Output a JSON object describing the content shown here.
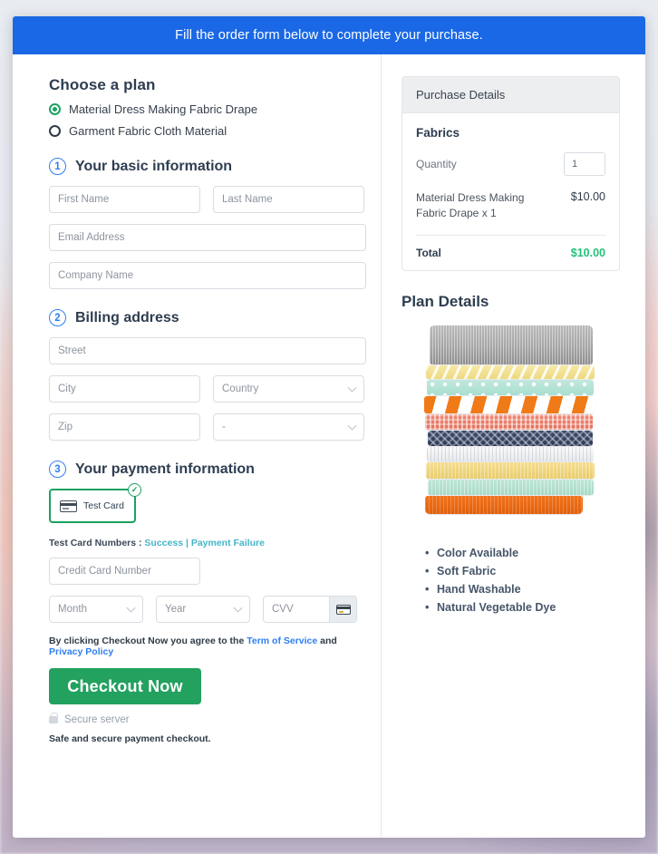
{
  "banner": {
    "text": "Fill the order form below to complete your purchase."
  },
  "plan": {
    "heading": "Choose a plan",
    "options": [
      {
        "label": "Material Dress Making Fabric Drape",
        "selected": true
      },
      {
        "label": "Garment Fabric Cloth Material",
        "selected": false
      }
    ]
  },
  "steps": {
    "basic": {
      "num": "1",
      "title": "Your basic information"
    },
    "billing": {
      "num": "2",
      "title": "Billing address"
    },
    "payment": {
      "num": "3",
      "title": "Your payment information"
    }
  },
  "fields": {
    "first_name": "First Name",
    "last_name": "Last Name",
    "email": "Email Address",
    "company": "Company Name",
    "street": "Street",
    "city": "City",
    "country": "Country",
    "zip": "Zip",
    "state": "-",
    "credit_card": "Credit Card Number",
    "month": "Month",
    "year": "Year",
    "cvv": "CVV"
  },
  "payment": {
    "tile_label": "Test  Card",
    "tile_selected": true,
    "check_glyph": "✓",
    "testcards_prefix": "Test Card Numbers : ",
    "testcards_success": "Success",
    "testcards_sep": " | ",
    "testcards_failure": "Payment Failure"
  },
  "terms": {
    "prefix": "By clicking Checkout Now you agree to the ",
    "tos": "Term of Service",
    "mid": " and ",
    "privacy": "Privacy Policy"
  },
  "checkout": {
    "button_label": "Checkout Now",
    "secure_label": "Secure server",
    "safe_label": "Safe and secure payment checkout."
  },
  "purchase": {
    "header": "Purchase Details",
    "group_title": "Fabrics",
    "quantity_label": "Quantity",
    "quantity_value": "1",
    "item_name": "Material Dress Making Fabric Drape x 1",
    "item_price": "$10.00",
    "total_label": "Total",
    "total_price": "$10.00"
  },
  "plan_details": {
    "title": "Plan Details",
    "image_alt": "stack-of-folded-fabrics",
    "features": [
      "Color Available",
      "Soft Fabric",
      "Hand Washable",
      "Natural Vegetable Dye"
    ]
  },
  "colors": {
    "banner_blue": "#1a68e5",
    "accent_green": "#22a15f",
    "total_green": "#22c07a",
    "step_blue": "#2f7ef0",
    "link_teal": "#45b5c9",
    "link_blue": "#2f7ef0"
  }
}
